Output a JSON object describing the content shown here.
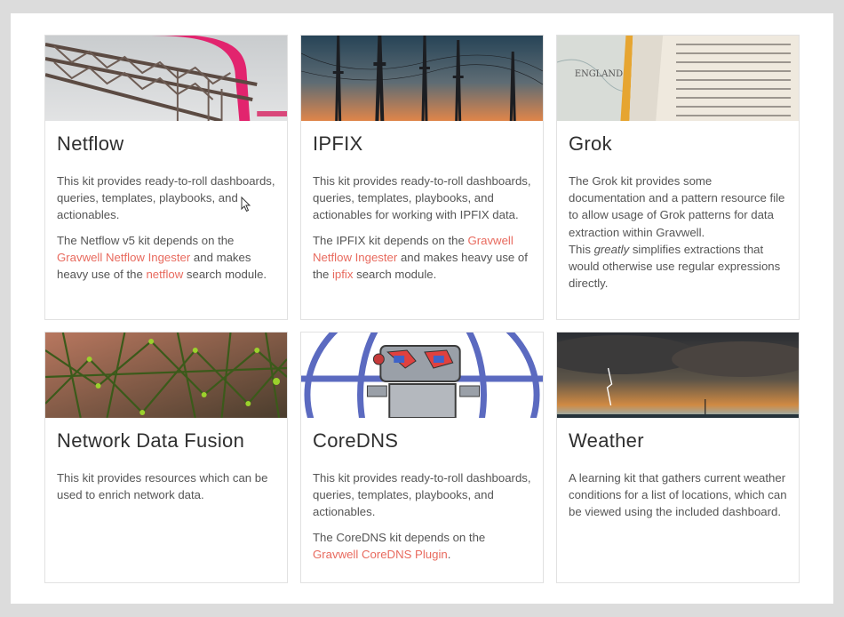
{
  "cards": [
    {
      "title": "Netflow",
      "p1": "This kit provides ready-to-roll dashboards, queries, templates, playbooks, and actionables.",
      "p2a": "The Netflow v5 kit depends on the ",
      "link1": "Gravwell Netflow Ingester",
      "p2b": " and makes heavy use of the ",
      "link2": "netflow",
      "p2c": " search module."
    },
    {
      "title": "IPFIX",
      "p1": "This kit provides ready-to-roll dashboards, queries, templates, playbooks, and actionables for working with IPFIX data.",
      "p2a": "The IPFIX kit depends on the ",
      "link1": "Gravwell Netflow Ingester",
      "p2b": " and makes heavy use of the ",
      "link2": "ipfix",
      "p2c": " search module."
    },
    {
      "title": "Grok",
      "p1": "The Grok kit provides some documentation and a pattern resource file to allow usage of Grok patterns for data extraction within Gravwell.",
      "p2a": "This ",
      "em": "greatly",
      "p2b": " simplifies extractions that would otherwise use regular expressions directly."
    },
    {
      "title": "Network Data Fusion",
      "p1": "This kit provides resources which can be used to enrich network data."
    },
    {
      "title": "CoreDNS",
      "p1": "This kit provides ready-to-roll dashboards, queries, templates, playbooks, and actionables.",
      "p2a": "The CoreDNS kit depends on the ",
      "link1": "Gravwell CoreDNS Plugin",
      "p2b": "."
    },
    {
      "title": "Weather",
      "p1": "A learning kit that gathers current weather conditions for a list of locations, which can be viewed using the included dashboard."
    }
  ],
  "thumbnail_image_text": "ENGLAND",
  "colors": {
    "link": "#e86a5e",
    "title": "#2f2f2f",
    "body": "#555555",
    "border": "#e1e1e1"
  }
}
